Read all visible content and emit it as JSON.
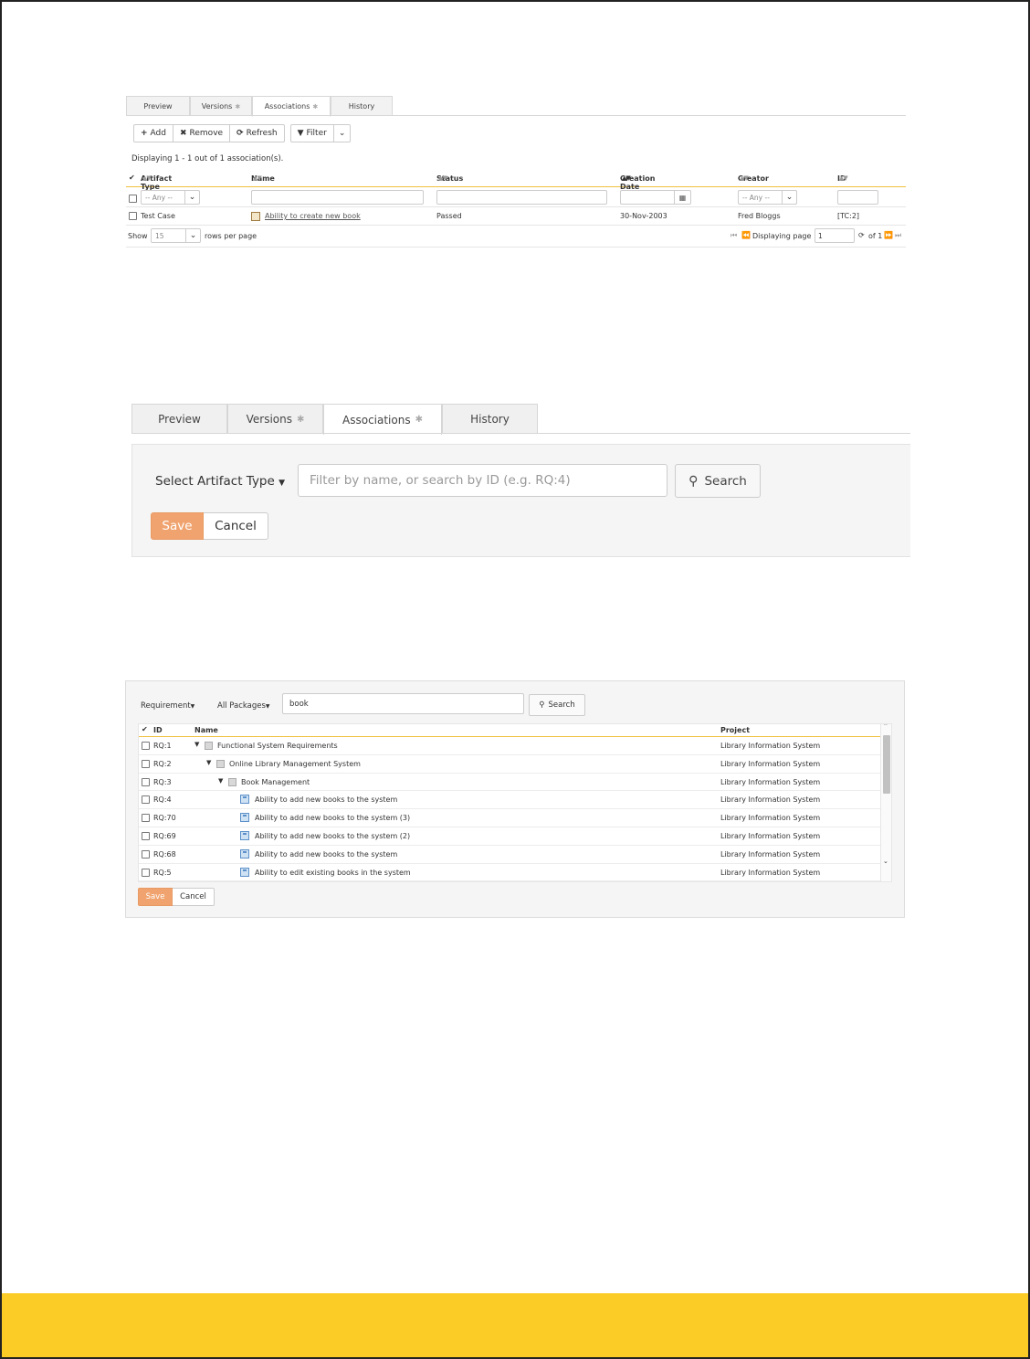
{
  "panel1": {
    "tabs": [
      {
        "label": "Preview",
        "star": false
      },
      {
        "label": "Versions",
        "star": true
      },
      {
        "label": "Associations",
        "star": true
      },
      {
        "label": "History",
        "star": false
      }
    ],
    "toolbar": {
      "add": "Add",
      "remove": "Remove",
      "refresh": "Refresh",
      "filter": "Filter"
    },
    "displaying": "Displaying 1 - 1 out of 1 association(s).",
    "columns": {
      "artifact_type": "Artifact Type",
      "name": "Name",
      "status": "Status",
      "creation_date": "Creation Date",
      "creator": "Creator",
      "id": "ID"
    },
    "filters": {
      "artifact_any": "-- Any --",
      "creator_any": "-- Any --"
    },
    "row": {
      "artifact_type": "Test Case",
      "name": "Ability to create new book",
      "status": "Passed",
      "creation_date": "30-Nov-2003",
      "creator": "Fred Bloggs",
      "id": "[TC:2]"
    },
    "pager": {
      "show": "Show",
      "rows_value": "15",
      "rows_per_page": "rows per page",
      "displaying_page": "Displaying page",
      "page": "1",
      "of": "of 1"
    }
  },
  "panel2": {
    "tabs": [
      {
        "label": "Preview",
        "star": false
      },
      {
        "label": "Versions",
        "star": true
      },
      {
        "label": "Associations",
        "star": true
      },
      {
        "label": "History",
        "star": false
      }
    ],
    "select_artifact_type": "Select Artifact Type",
    "filter_placeholder": "Filter by name, or search by ID (e.g. RQ:4)",
    "search": "Search",
    "save": "Save",
    "cancel": "Cancel"
  },
  "panel3": {
    "type_dropdown": "Requirement",
    "packages_dropdown": "All Packages",
    "search_value": "book",
    "search": "Search",
    "columns": {
      "id": "ID",
      "name": "Name",
      "project": "Project"
    },
    "rows": [
      {
        "id": "RQ:1",
        "name": "Functional System Requirements",
        "project": "Library Information System",
        "level": 0,
        "kind": "folder"
      },
      {
        "id": "RQ:2",
        "name": "Online Library Management System",
        "project": "Library Information System",
        "level": 1,
        "kind": "folder"
      },
      {
        "id": "RQ:3",
        "name": "Book Management",
        "project": "Library Information System",
        "level": 2,
        "kind": "folder"
      },
      {
        "id": "RQ:4",
        "name": "Ability to add new books to the system",
        "project": "Library Information System",
        "level": 3,
        "kind": "req"
      },
      {
        "id": "RQ:70",
        "name": "Ability to add new books to the system (3)",
        "project": "Library Information System",
        "level": 3,
        "kind": "req"
      },
      {
        "id": "RQ:69",
        "name": "Ability to add new books to the system (2)",
        "project": "Library Information System",
        "level": 3,
        "kind": "req"
      },
      {
        "id": "RQ:68",
        "name": "Ability to add new books to the system",
        "project": "Library Information System",
        "level": 3,
        "kind": "req"
      },
      {
        "id": "RQ:5",
        "name": "Ability to edit existing books in the system",
        "project": "Library Information System",
        "level": 3,
        "kind": "req"
      }
    ],
    "save": "Save",
    "cancel": "Cancel"
  }
}
